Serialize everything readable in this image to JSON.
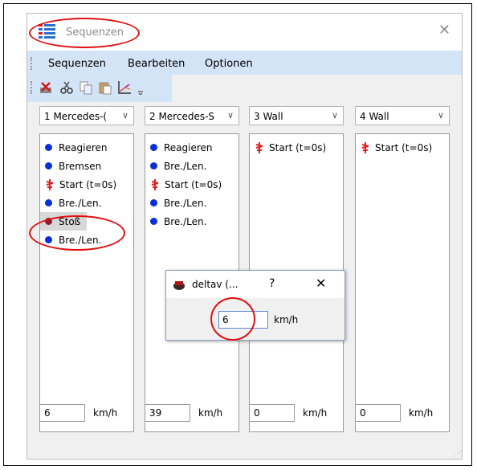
{
  "window": {
    "title": "Sequenzen",
    "close_glyph": "✕"
  },
  "menu": [
    "Sequenzen",
    "Bearbeiten",
    "Optionen"
  ],
  "toolbar": {
    "icons": [
      "delete-icon",
      "cut-icon",
      "copy-icon",
      "paste-icon",
      "chart-icon",
      "overflow-icon"
    ]
  },
  "columns": [
    {
      "dropdown": "1 Mercedes-(",
      "items": [
        {
          "label": "Reagieren",
          "marker": "dot"
        },
        {
          "label": "Bremsen",
          "marker": "dot"
        },
        {
          "label": "Start (t=0s)",
          "marker": "flag"
        },
        {
          "label": "Bre./Len.",
          "marker": "dot"
        },
        {
          "label": "Stoß",
          "marker": "dot-dark"
        },
        {
          "label": "Bre./Len.",
          "marker": "dot"
        }
      ],
      "value": "6",
      "unit": "km/h"
    },
    {
      "dropdown": "2 Mercedes-S",
      "items": [
        {
          "label": "Reagieren",
          "marker": "dot"
        },
        {
          "label": "Bre./Len.",
          "marker": "dot"
        },
        {
          "label": "Start (t=0s)",
          "marker": "flag"
        },
        {
          "label": "Bre./Len.",
          "marker": "dot"
        },
        {
          "label": "Bre./Len.",
          "marker": "dot"
        }
      ],
      "value": "39",
      "unit": "km/h"
    },
    {
      "dropdown": "3 Wall",
      "items": [
        {
          "label": "Start (t=0s)",
          "marker": "flag"
        }
      ],
      "value": "0",
      "unit": "km/h"
    },
    {
      "dropdown": "4 Wall",
      "items": [
        {
          "label": "Start (t=0s)",
          "marker": "flag"
        }
      ],
      "value": "0",
      "unit": "km/h"
    }
  ],
  "dialog": {
    "title": "deltav (...",
    "help": "?",
    "close": "✕",
    "value": "6",
    "unit": "km/h"
  },
  "colors": {
    "menubar": "#d4e4f7",
    "accent_blue": "#0a2fd6",
    "flag_red": "#e02020",
    "annotation_red": "#e01010"
  }
}
